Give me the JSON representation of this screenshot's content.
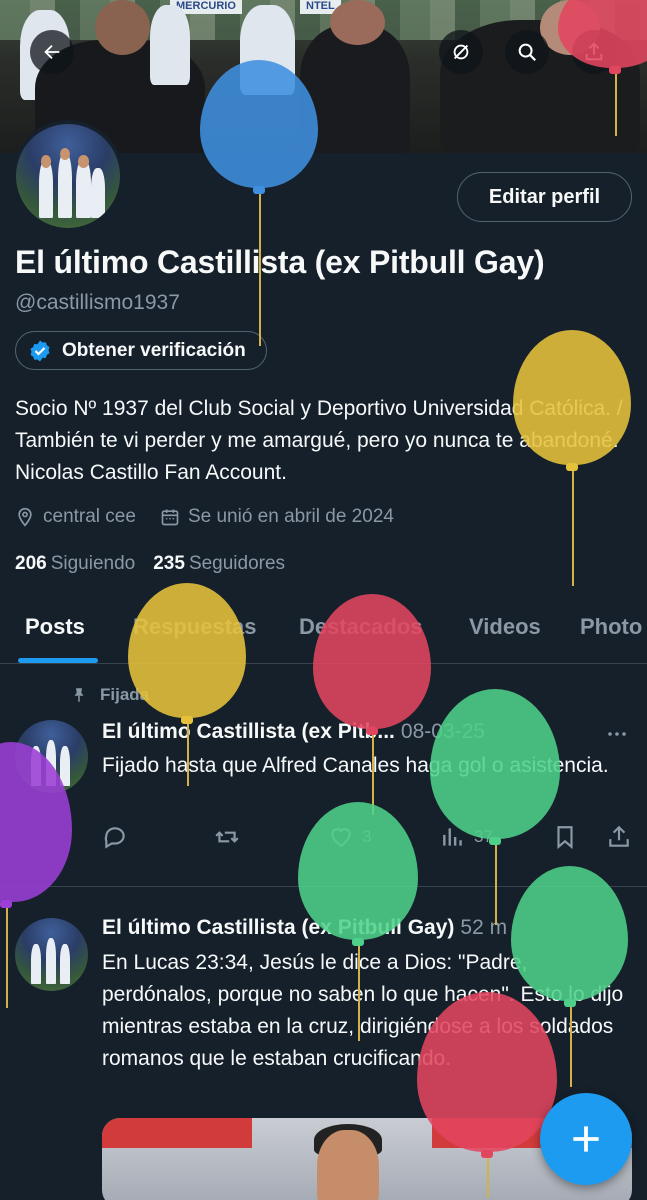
{
  "profile": {
    "name": "El último Castillista (ex Pitbull Gay)",
    "handle": "@castillismo1937",
    "edit_label": "Editar perfil",
    "verify_label": "Obtener verificación",
    "bio": "Socio Nº 1937 del Club Social y Deportivo Universidad Católica. / También te vi perder y me amargué, pero yo nunca te abandoné. Nicolas Castillo Fan Account.",
    "location": "central cee",
    "joined": "Se unió en abril de 2024",
    "following_count": "206",
    "following_label": "Siguiendo",
    "followers_count": "235",
    "followers_label": "Seguidores"
  },
  "banner": {
    "sign_left": "MERCURIO",
    "sign_right": "NTEL"
  },
  "tabs": [
    {
      "label": "Posts"
    },
    {
      "label": "Respuestas"
    },
    {
      "label": "Destacados"
    },
    {
      "label": "Videos"
    },
    {
      "label": "Photo"
    }
  ],
  "pinned_label": "Fijada",
  "posts": [
    {
      "author": "El último Castillista (ex Pitbull Gay)",
      "author_short": "El último Castillista (ex Pitb...",
      "time": "08-03-25",
      "text": "Fijado hasta que Alfred Canales haga gol o asistencia.",
      "replies": "",
      "reposts": "",
      "likes": "3",
      "views": "37"
    },
    {
      "author": "El último Castillista (ex Pitbull Gay)",
      "time": "52 m",
      "text": "En Lucas 23:34, Jesús le dice a Dios: \"Padre, perdónalos, porque no saben lo que hacen\". Esto lo dijo mientras estaba en la cruz, dirigiéndose a los soldados romanos que le estaban crucificando."
    }
  ],
  "colors": {
    "background": "#15202b",
    "accent": "#1d9bf0",
    "muted": "#8b98a5",
    "border": "#38444d",
    "balloon_blue": "#3f8fe0",
    "balloon_yellow": "#e6c13b",
    "balloon_red": "#e2465f",
    "balloon_green": "#4fd08a",
    "balloon_purple": "#9b3fd6"
  },
  "icons": [
    "back-arrow-icon",
    "grok-icon",
    "search-icon",
    "share-icon",
    "verified-badge-icon",
    "location-icon",
    "calendar-icon",
    "pin-icon",
    "more-icon",
    "reply-icon",
    "repost-icon",
    "like-icon",
    "views-icon",
    "bookmark-icon",
    "compose-plus-icon"
  ]
}
